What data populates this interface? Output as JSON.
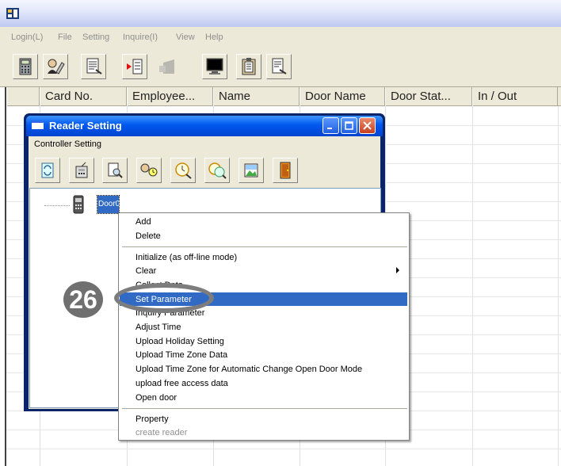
{
  "menubar": {
    "items": [
      "Login(L)",
      "File",
      "Setting",
      "Inquire(I)",
      "View",
      "Help"
    ]
  },
  "toolbar": {
    "icons": [
      "calculator-icon",
      "card-user-icon",
      "report-icon",
      "export-icon",
      "door-disabled-icon",
      "monitor-icon",
      "notebook-icon",
      "document-search-icon"
    ]
  },
  "grid": {
    "columns": [
      "Card No.",
      "Employee...",
      "Name",
      "Door Name",
      "Door Stat...",
      "In / Out"
    ]
  },
  "reader_setting": {
    "title": "Reader Setting",
    "menu": "Controller Setting",
    "tree_item": "Door001"
  },
  "context_menu": {
    "items": [
      {
        "label": "Add"
      },
      {
        "label": "Delete"
      },
      {
        "label": "Initialize (as off-line mode)"
      },
      {
        "label": "Clear"
      },
      {
        "label": "Collect Data"
      },
      {
        "label": "Set Parameter"
      },
      {
        "label": "Inquiry Parameter"
      },
      {
        "label": "Adjust Time"
      },
      {
        "label": "Upload Holiday Setting"
      },
      {
        "label": "Upload Time Zone Data"
      },
      {
        "label": "Upload Time Zone for  Automatic Change Open Door Mode"
      },
      {
        "label": "upload free access data"
      },
      {
        "label": "Open door"
      },
      {
        "label": "Property"
      },
      {
        "label": "create reader"
      }
    ],
    "selected": "Set Parameter"
  },
  "step_badge": "26",
  "colors": {
    "selection": "#316ac5",
    "title_blue": "#0058ee",
    "badge_gray": "#707070"
  }
}
